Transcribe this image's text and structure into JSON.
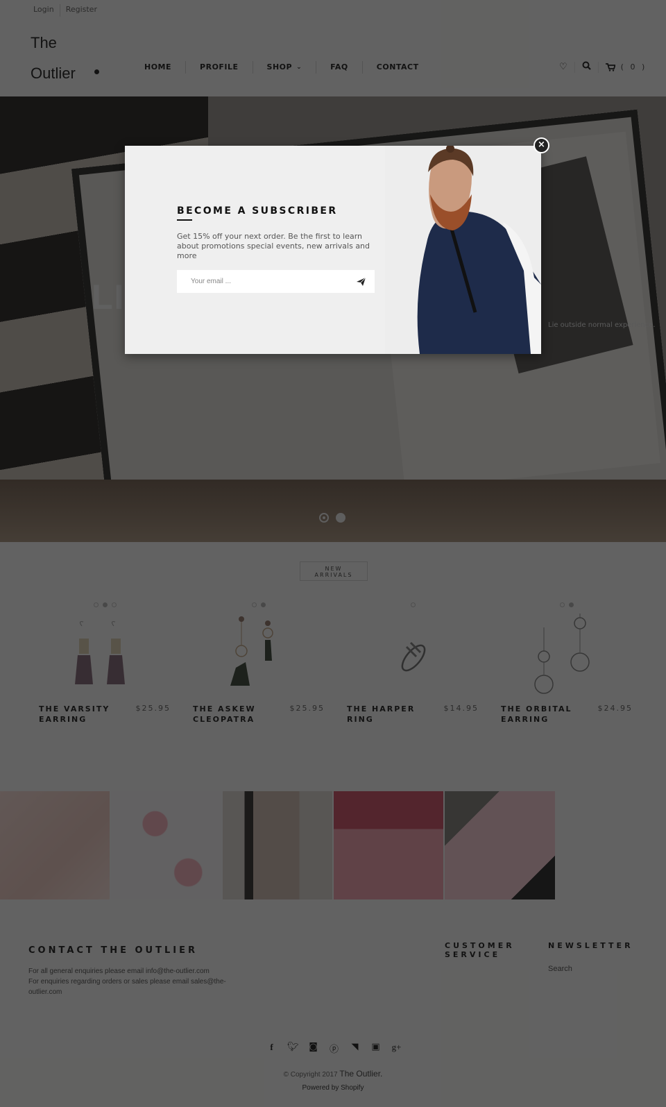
{
  "topbar": {
    "login": "Login",
    "register": "Register"
  },
  "logo": {
    "line1": "The",
    "line2": "Outlier"
  },
  "nav": {
    "items": [
      {
        "label": "HOME"
      },
      {
        "label": "PROFILE"
      },
      {
        "label": "SHOP",
        "has_dropdown": true
      },
      {
        "label": "FAQ"
      },
      {
        "label": "CONTACT"
      }
    ]
  },
  "header_icons": {
    "wishlist": "heart-icon",
    "search": "search-icon",
    "cart": "cart-icon",
    "cart_count": "( 0 )"
  },
  "hero": {
    "title_partial": "LI",
    "subtitle_partial": "Lie outside normal experience.",
    "slides": 2,
    "active_slide": 1
  },
  "new_arrivals": {
    "label_line1": "NEW",
    "label_line2": "ARRIVALS"
  },
  "products": [
    {
      "name": "THE VARSITY EARRING",
      "price": "$25.95",
      "swatches": 3,
      "active_swatch": 2
    },
    {
      "name": "THE ASKEW CLEOPATRA EARRING",
      "price": "$25.95",
      "swatches": 2,
      "active_swatch": 2
    },
    {
      "name": "THE HARPER RING",
      "price": "$14.95",
      "swatches": 1,
      "active_swatch": 0
    },
    {
      "name": "THE ORBITAL EARRING",
      "price": "$24.95",
      "swatches": 2,
      "active_swatch": 2
    }
  ],
  "instagram": {
    "tiles": 6
  },
  "footer": {
    "contact_title": "CONTACT THE OUTLIER",
    "contact_line1": "For all general enquiries please email info@the-outlier.com",
    "contact_line2": "For enquiries regarding orders or sales please email sales@the-outlier.com",
    "customer_service_title": "CUSTOMER SERVICE",
    "newsletter_title": "NEWSLETTER",
    "newsletter_link": "Search",
    "social": [
      "facebook-icon",
      "twitter-icon",
      "instagram-icon",
      "pinterest-icon",
      "rss-icon",
      "youtube-icon",
      "google-plus-icon"
    ],
    "copyright_prefix": "© Copyright 2017",
    "copyright_brand": "The Outlier.",
    "powered": "Powered by Shopify"
  },
  "popup": {
    "title": "BECOME A SUBSCRIBER",
    "text": "Get 15% off your next order. Be the first to learn about promotions special events, new arrivals and more",
    "email_placeholder": "Your email ...",
    "email_value": "",
    "close_label": "×"
  },
  "colors": {
    "overlay": "#5b5a59",
    "popup_bg": "#efefef",
    "accent_dark": "#111111"
  }
}
